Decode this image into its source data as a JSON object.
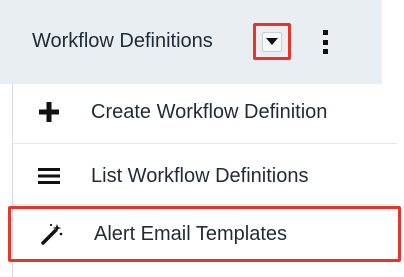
{
  "header": {
    "module_tab_label": "Workflow Definitions",
    "dropdown_icon": "caret-down-icon",
    "more_icon": "kebab-menu-icon"
  },
  "menu": {
    "items": [
      {
        "label": "Create Workflow Definition",
        "icon": "plus-icon"
      },
      {
        "label": "List Workflow Definitions",
        "icon": "list-icon"
      },
      {
        "label": "Alert Email Templates",
        "icon": "magic-wand-icon"
      }
    ]
  },
  "colors": {
    "header_bg": "#e8eef2",
    "highlight": "#e8352a",
    "text": "#1f2b36"
  }
}
